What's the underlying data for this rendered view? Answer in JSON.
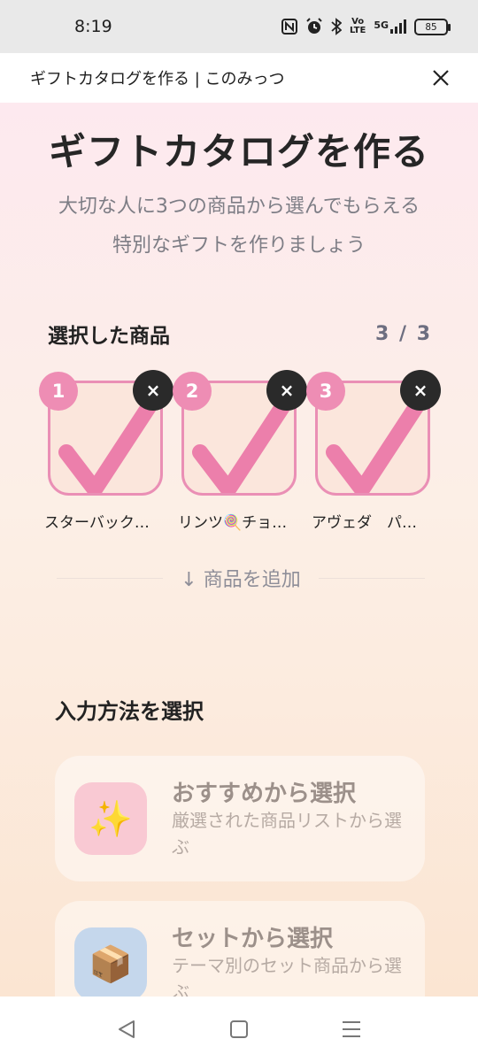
{
  "status_bar": {
    "time": "8:19",
    "battery": "85",
    "icons": [
      "nfc-icon",
      "alarm-icon",
      "bluetooth-icon",
      "volte-icon",
      "5g-signal-icon",
      "battery-icon"
    ],
    "volte_label": "Vo\nLTE",
    "network_label": "5G"
  },
  "header": {
    "title": "ギフトカタログを作る | このみっつ",
    "close_icon": "close-icon"
  },
  "main": {
    "title": "ギフトカタログを作る",
    "subtitle_line1": "大切な人に3つの商品から選んでもらえる",
    "subtitle_line2": "特別なギフトを作りましょう",
    "selected_title": "選択した商品",
    "selected_count": "3 / 3",
    "products": [
      {
        "number": "1",
        "name": "スターバック…",
        "remove": "×"
      },
      {
        "number": "2",
        "name": "リンツ🍭チョ…",
        "remove": "×"
      },
      {
        "number": "3",
        "name": "アヴェダ　パ…",
        "remove": "×"
      }
    ],
    "add_label": "↓ 商品を追加",
    "method_title": "入力方法を選択",
    "methods": [
      {
        "icon": "✨",
        "icon_name": "sparkles-icon",
        "title": "おすすめから選択",
        "desc": "厳選された商品リストから選ぶ"
      },
      {
        "icon": "📦",
        "icon_name": "package-icon",
        "title": "セットから選択",
        "desc": "テーマ別のセット商品から選ぶ"
      }
    ]
  },
  "colors": {
    "accent_pink": "#ee8db4",
    "checkmark": "#ec7fab",
    "remove_dark": "#2a2a2a"
  },
  "nav": {
    "back_icon": "back-triangle-icon",
    "home_icon": "home-square-icon",
    "menu_icon": "menu-lines-icon"
  }
}
